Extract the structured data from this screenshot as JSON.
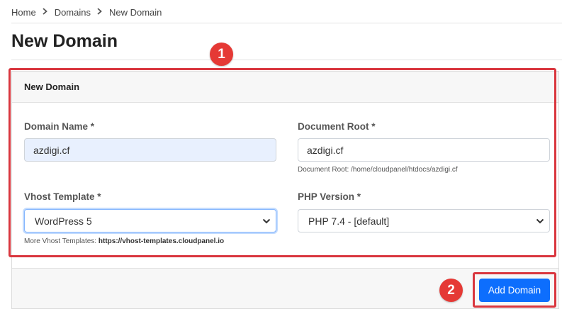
{
  "breadcrumb": {
    "items": [
      "Home",
      "Domains"
    ],
    "current": "New Domain"
  },
  "page_title": "New Domain",
  "card": {
    "header": "New Domain",
    "domain_name": {
      "label": "Domain Name *",
      "value": "azdigi.cf"
    },
    "document_root": {
      "label": "Document Root *",
      "value": "azdigi.cf",
      "help": "Document Root: /home/cloudpanel/htdocs/azdigi.cf"
    },
    "vhost_template": {
      "label": "Vhost Template *",
      "selected": "WordPress 5",
      "help_prefix": "More Vhost Templates:",
      "help_link": "https://vhost-templates.cloudpanel.io"
    },
    "php_version": {
      "label": "PHP Version *",
      "selected": "PHP 7.4 - [default]"
    },
    "submit_label": "Add Domain"
  },
  "annotations": {
    "badge_1": "1",
    "badge_2": "2"
  },
  "colors": {
    "primary": "#0d6efd",
    "annotation": "#d9363e"
  }
}
